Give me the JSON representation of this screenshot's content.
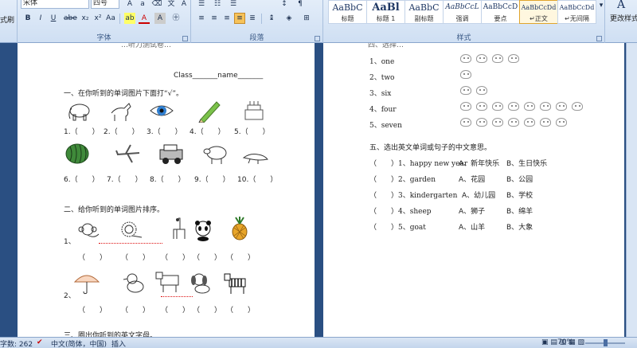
{
  "ribbon": {
    "left_label": "式刷",
    "font": {
      "name": "宋体",
      "size": "四号",
      "group_label": "字体"
    },
    "paragraph": {
      "group_label": "段落"
    },
    "styles": {
      "group_label": "样式",
      "items": [
        {
          "preview": "AaBbC",
          "name": "标题"
        },
        {
          "preview": "AaBl",
          "name": "标题 1"
        },
        {
          "preview": "AaBbC",
          "name": "副标题"
        },
        {
          "preview": "AaBbCcL",
          "name": "强调"
        },
        {
          "preview": "AaBbCcD",
          "name": "要点"
        },
        {
          "preview": "AaBbCcDd",
          "name": "↵正文"
        },
        {
          "preview": "AaBbCcDd",
          "name": "↵无间隔"
        }
      ],
      "change_styles_label": "更改样式"
    }
  },
  "page1": {
    "heading_partial": "…听力测试卷…",
    "class_name_line": "Class_______name_______",
    "section1": {
      "title": "一、在你听到的单词图片下面打“√”。",
      "row1_captions": [
        "1.（　　）",
        "2.（　　）",
        "3.（　　）",
        "4.（　　）",
        "5.（　　）"
      ],
      "row2_captions": [
        "6.（　　）",
        "7.（　　）",
        "8.（　　）",
        "9.（　　）",
        "10.（　　）"
      ]
    },
    "section2": {
      "title": "二、给你听到的单词图片排序。",
      "row1_label": "1、",
      "row2_label": "2、",
      "parens": [
        "（　　）",
        "（　　）",
        "（　　）",
        "（　　）",
        "（　　）"
      ]
    },
    "section3_partial": "三、圈出你听到的英文字母。"
  },
  "page2": {
    "section4_partial": "四、选择…",
    "counting": [
      {
        "label": "1、one",
        "icons": 4
      },
      {
        "label": "2、two",
        "icons": 1
      },
      {
        "label": "3、six",
        "icons": 2
      },
      {
        "label": "4、four",
        "icons": 8
      },
      {
        "label": "5、seven",
        "icons": 7
      }
    ],
    "section5": {
      "title": "五、选出英文单词或句子的中文意思。",
      "rows": [
        {
          "num": "（　　）1、happy new year",
          "a": "A、新年快乐",
          "b": "B、生日快乐"
        },
        {
          "num": "（　　）2、garden",
          "a": "A、花园",
          "b": "B、公园"
        },
        {
          "num": "（　　）3、kindergarten",
          "a": "A、幼儿园",
          "b": "B、学校"
        },
        {
          "num": "（　　）4、sheep",
          "a": "A、狮子",
          "b": "B、绵羊"
        },
        {
          "num": "（　　）5、goat",
          "a": "A、山羊",
          "b": "B、大象"
        }
      ]
    }
  },
  "statusbar": {
    "word_count": "字数: 262",
    "language": "中文(简体，中国)",
    "mode": "插入",
    "zoom": "70%"
  }
}
